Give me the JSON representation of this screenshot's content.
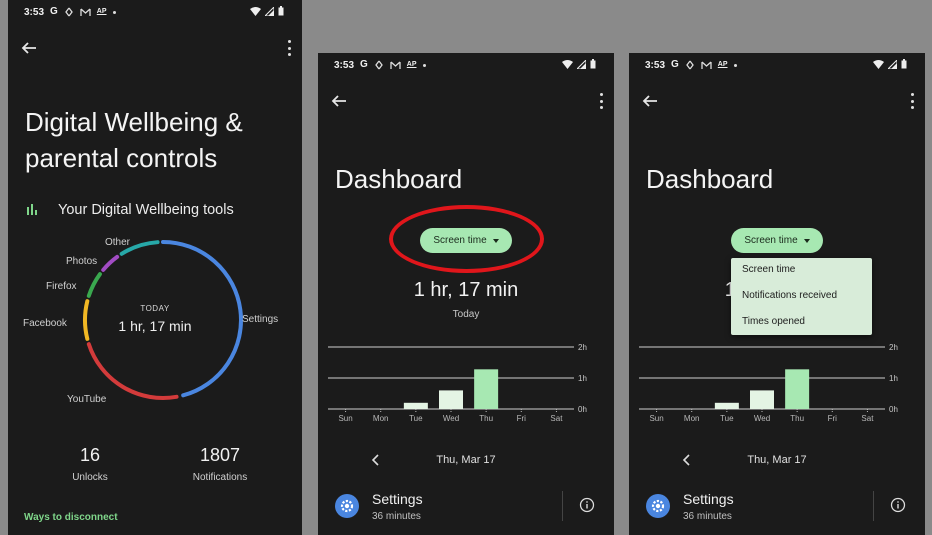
{
  "status": {
    "time": "3:53",
    "carrier_icon": "G",
    "ap_badge": "AP"
  },
  "panel1": {
    "title": "Digital Wellbeing & parental controls",
    "tools_label": "Your Digital Wellbeing tools",
    "ring": {
      "center_small": "TODAY",
      "center_big": "1 hr, 17 min",
      "segments": [
        {
          "name": "Settings",
          "color": "#4a86e0"
        },
        {
          "name": "YouTube",
          "color": "#d33b3b"
        },
        {
          "name": "Facebook",
          "color": "#f2b824"
        },
        {
          "name": "Firefox",
          "color": "#3aa84f"
        },
        {
          "name": "Photos",
          "color": "#a24cc4"
        },
        {
          "name": "Other",
          "color": "#27a8a8"
        }
      ]
    },
    "unlocks": {
      "value": "16",
      "label": "Unlocks"
    },
    "notifications": {
      "value": "1807",
      "label": "Notifications"
    },
    "ways_link": "Ways to disconnect"
  },
  "dashboard": {
    "title": "Dashboard",
    "dropdown_label": "Screen time",
    "total_time": "1 hr, 17 min",
    "period": "Today",
    "date": "Thu, Mar 17",
    "app": {
      "name": "Settings",
      "duration": "36 minutes"
    }
  },
  "dropdown_menu": {
    "options": [
      "Screen time",
      "Notifications received",
      "Times opened"
    ]
  },
  "chart_data": {
    "type": "bar",
    "categories": [
      "Sun",
      "Mon",
      "Tue",
      "Wed",
      "Thu",
      "Fri",
      "Sat"
    ],
    "values": [
      0,
      0,
      0.2,
      0.6,
      1.28,
      0,
      0
    ],
    "ylabel": "",
    "y_ticks": [
      "0h",
      "1h",
      "2h"
    ],
    "ylim": [
      0,
      2
    ],
    "highlight_category": "Thu",
    "colors": {
      "normal": "#e4f4e4",
      "highlight": "#a7e8b2"
    }
  }
}
